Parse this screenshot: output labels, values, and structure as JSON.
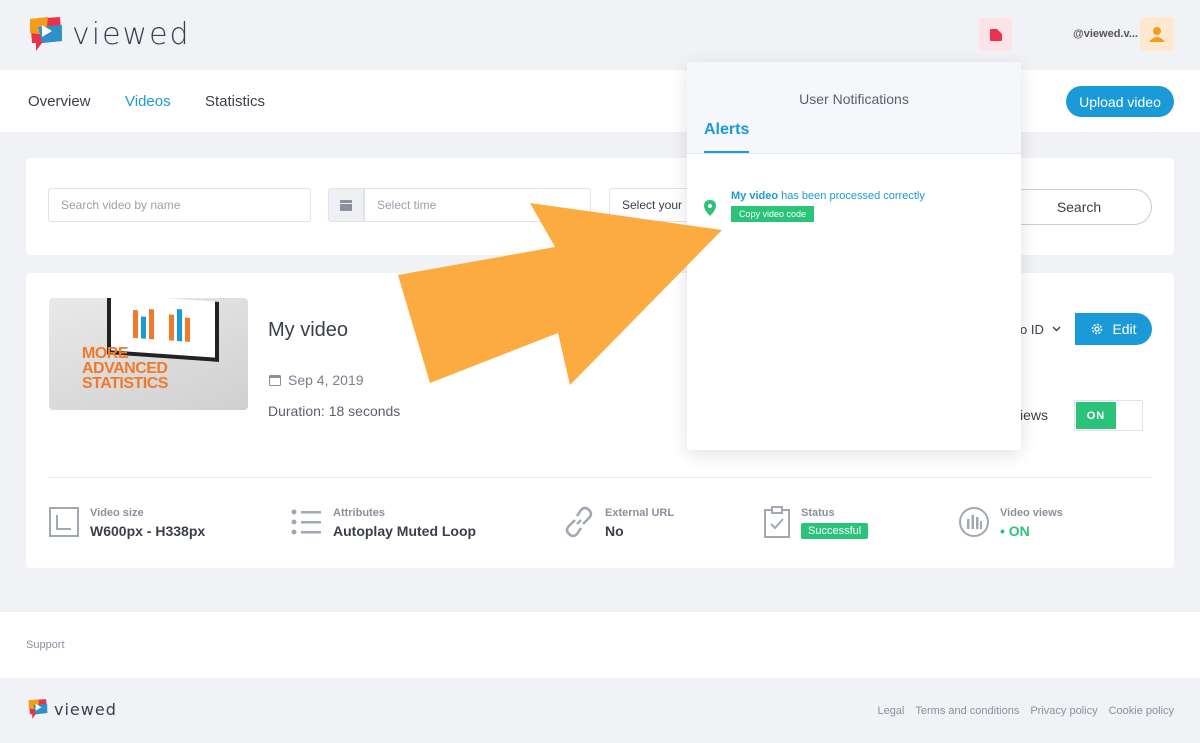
{
  "header": {
    "logo_text": "viewed",
    "user_handle": "@viewed.v...",
    "icons": {
      "notifications": "notification-icon",
      "avatar": "user-icon"
    }
  },
  "nav": {
    "tabs": [
      {
        "label": "Overview",
        "active": false
      },
      {
        "label": "Videos",
        "active": true
      },
      {
        "label": "Statistics",
        "active": false
      }
    ],
    "upload_label": "Upload video"
  },
  "search": {
    "name_placeholder": "Search video by name",
    "time_placeholder": "Select time",
    "extra_select": "Select your",
    "search_label": "Search"
  },
  "video": {
    "title": "My video",
    "date": "Sep 4, 2019",
    "duration": "Duration: 18 seconds",
    "thumbnail_text": [
      "MORE",
      "ADVANCED",
      "STATISTICS"
    ],
    "id_select": "o ID",
    "edit_label": "Edit",
    "views_label": "iews",
    "toggle_label": "ON",
    "stats": [
      {
        "label": "Video size",
        "value": "W600px - H338px",
        "icon": "resize-icon"
      },
      {
        "label": "Attributes",
        "value": "Autoplay Muted Loop",
        "icon": "list-icon"
      },
      {
        "label": "External URL",
        "value": "No",
        "icon": "link-icon"
      },
      {
        "label": "Status",
        "value": "Successful",
        "icon": "clipboard-check-icon"
      },
      {
        "label": "Video views",
        "value": "ON",
        "icon": "bar-chart-icon"
      }
    ]
  },
  "notifications": {
    "title": "User Notifications",
    "tab": "Alerts",
    "item": {
      "video_name": "My video",
      "message": " has been processed correctly",
      "button": "Copy video code"
    }
  },
  "footer": {
    "support": "Support",
    "links": [
      "Legal",
      "Terms and conditions",
      "Privacy policy",
      "Cookie policy"
    ]
  },
  "colors": {
    "accent": "#1a9ad6",
    "success": "#2bc37a",
    "arrow": "#fcab41",
    "logo_orange": "#f07a2a"
  }
}
